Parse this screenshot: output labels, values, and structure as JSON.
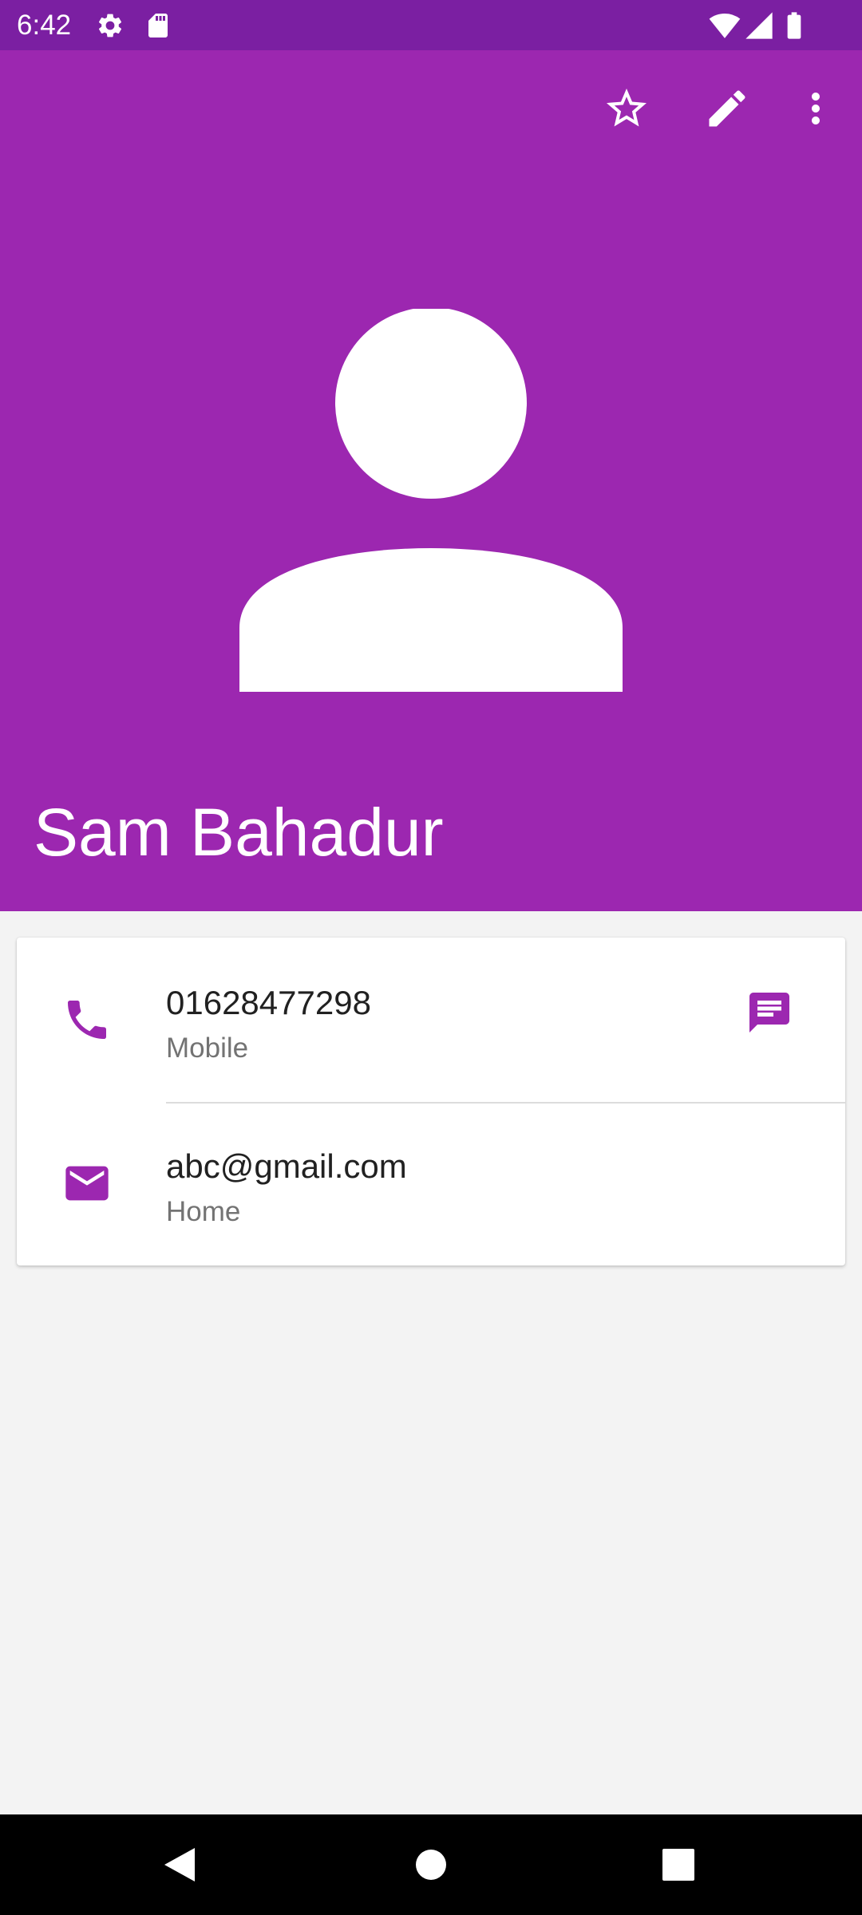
{
  "status_bar": {
    "time": "6:42",
    "left_icons": [
      "settings-icon",
      "sd-card-icon"
    ],
    "right_icons": [
      "wifi-icon",
      "signal-icon",
      "battery-icon"
    ]
  },
  "toolbar": {
    "actions": [
      "star-outline-icon",
      "edit-icon",
      "more-vert-icon"
    ]
  },
  "contact": {
    "name": "Sam Bahadur",
    "phone": {
      "number": "01628477298",
      "type": "Mobile"
    },
    "email": {
      "address": "abc@gmail.com",
      "type": "Home"
    }
  },
  "nav_bar": {
    "buttons": [
      "back-icon",
      "home-icon",
      "recents-icon"
    ]
  },
  "colors": {
    "status_bar": "#7b1fa2",
    "header": "#9c27b0",
    "accent": "#9c27b0",
    "background": "#f3f3f3"
  }
}
